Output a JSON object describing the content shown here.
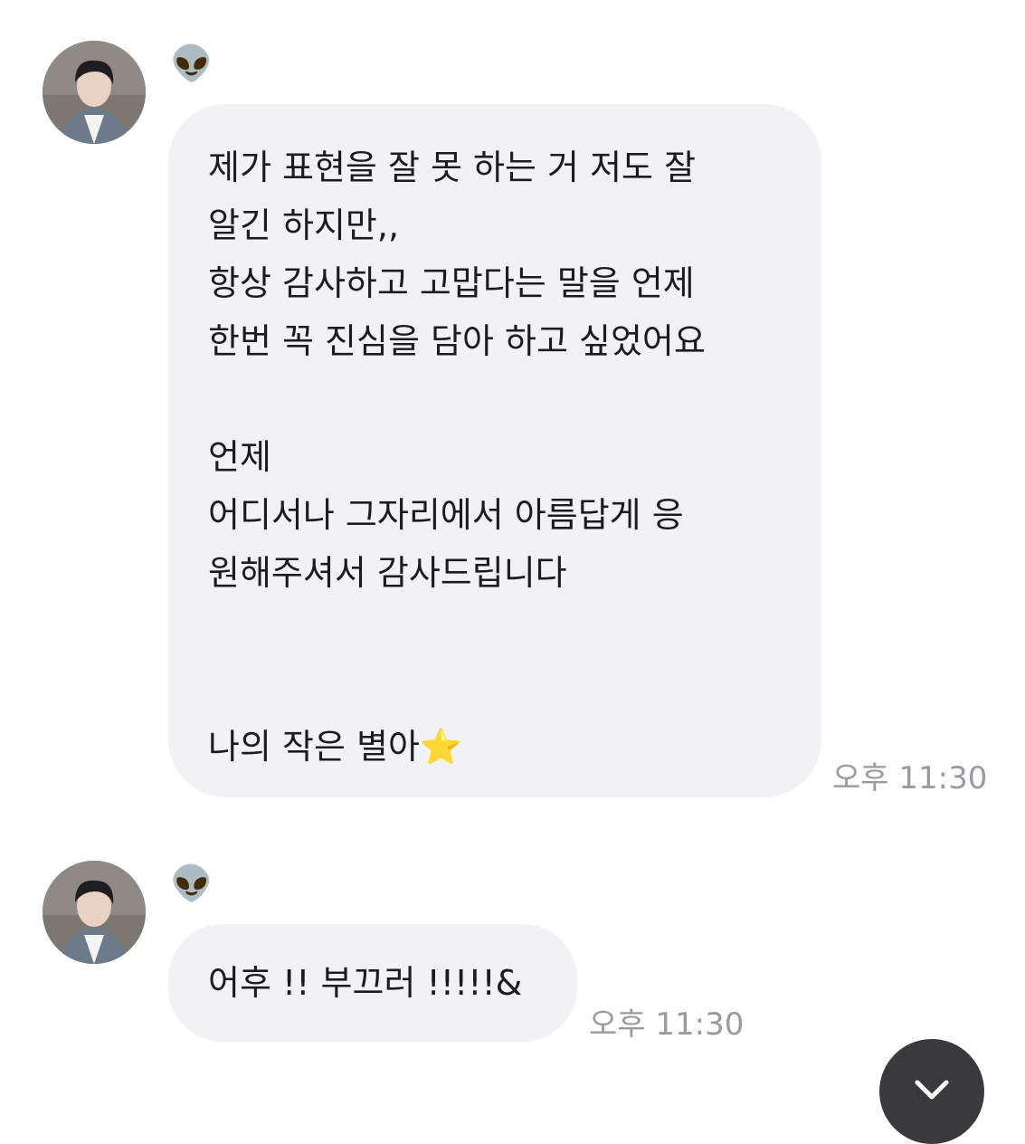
{
  "messages": [
    {
      "sender": "👽",
      "avatar_icon": "profile-photo",
      "text": "제가 표현을 잘 못 하는 거 저도 잘\n알긴 하지만,,\n항상 감사하고 고맙다는 말을 언제\n한번 꼭 진심을 담아 하고 싶었어요\n\n언제\n어디서나 그자리에서 아름답게 응\n원해주셔서 감사드립니다\n\n\n나의 작은 별아⭐️",
      "time": "오후 11:30"
    },
    {
      "sender": "👽",
      "avatar_icon": "profile-photo",
      "text": "어후 !! 부끄러 !!!!!&",
      "time": "오후 11:30"
    }
  ],
  "scroll_button": {
    "icon": "chevron-down-icon"
  },
  "colors": {
    "bubble": "#f2f2f5",
    "time": "#9a9aa0",
    "scroll_button": "#3a3a3c"
  }
}
